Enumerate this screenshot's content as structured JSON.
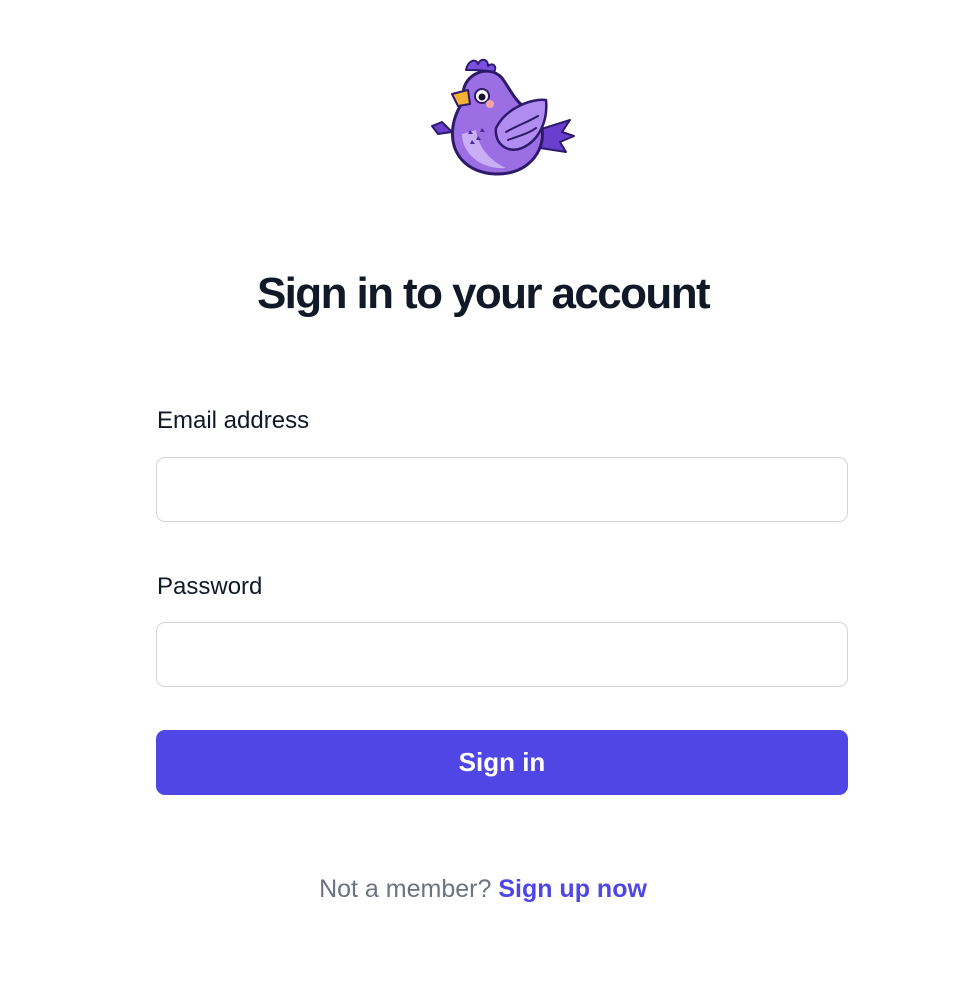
{
  "logo": {
    "icon": "purple-bird-mascot-icon",
    "colors": {
      "body": "#9b6fe3",
      "outline": "#2e1a6b",
      "beak": "#f2b234",
      "cheek": "#f4a6a6"
    }
  },
  "heading": {
    "title": "Sign in to your account"
  },
  "form": {
    "email_label": "Email address",
    "email_value": "",
    "password_label": "Password",
    "password_value": "",
    "submit_label": "Sign in"
  },
  "footer": {
    "prompt": "Not a member?",
    "link_label": "Sign up now"
  },
  "colors": {
    "accent": "#4f46e5",
    "text": "#111827",
    "muted": "#6b7280",
    "border": "#d1d5db"
  }
}
